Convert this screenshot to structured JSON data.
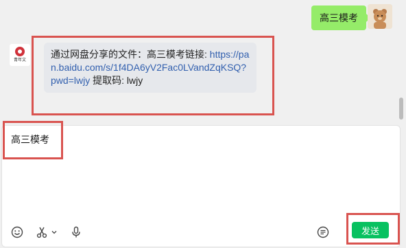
{
  "messages": {
    "outgoing": {
      "text": "高三模考"
    },
    "incoming": {
      "sender_label": "青年文",
      "prefix": "通过网盘分享的文件：高三模考链接: ",
      "link": "https://pan.baidu.com/s/1f4DA6yV2Fac0LVandZqKSQ?pwd=lwjy",
      "suffix": " 提取码: lwjy"
    }
  },
  "composer": {
    "text": "高三模考",
    "send_label": "发送"
  },
  "icons": [
    "emoji-icon",
    "scissors-icon",
    "chevron-down-icon",
    "microphone-icon",
    "chat-history-icon"
  ],
  "colors": {
    "chat_background": "#f0f0f0",
    "outgoing_bubble": "#95ec69",
    "incoming_bubble": "#e6e8ec",
    "send_button": "#07c160",
    "highlight": "#d9534f",
    "link": "#315fae"
  }
}
